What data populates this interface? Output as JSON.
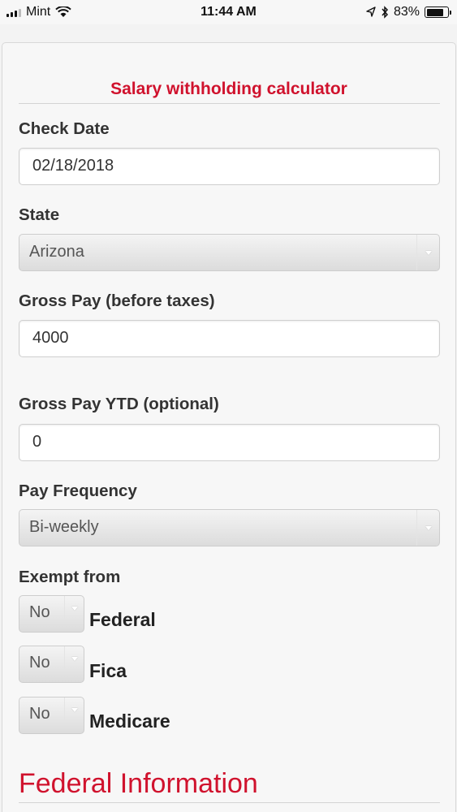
{
  "status_bar": {
    "carrier": "Mint",
    "time": "11:44 AM",
    "battery": "83%",
    "battery_level": 0.83
  },
  "calculator": {
    "title": "Salary withholding calculator",
    "check_date": {
      "label": "Check Date",
      "value": "02/18/2018"
    },
    "state": {
      "label": "State",
      "selected": "Arizona"
    },
    "gross_pay": {
      "label": "Gross Pay (before taxes)",
      "value": "4000"
    },
    "gross_pay_ytd": {
      "label": "Gross Pay YTD (optional)",
      "value": "0"
    },
    "pay_frequency": {
      "label": "Pay Frequency",
      "selected": "Bi-weekly"
    },
    "exempt": {
      "label": "Exempt from",
      "items": [
        {
          "selected": "No",
          "name": "Federal"
        },
        {
          "selected": "No",
          "name": "Fica"
        },
        {
          "selected": "No",
          "name": "Medicare"
        }
      ]
    },
    "federal_section_title": "Federal Information"
  }
}
